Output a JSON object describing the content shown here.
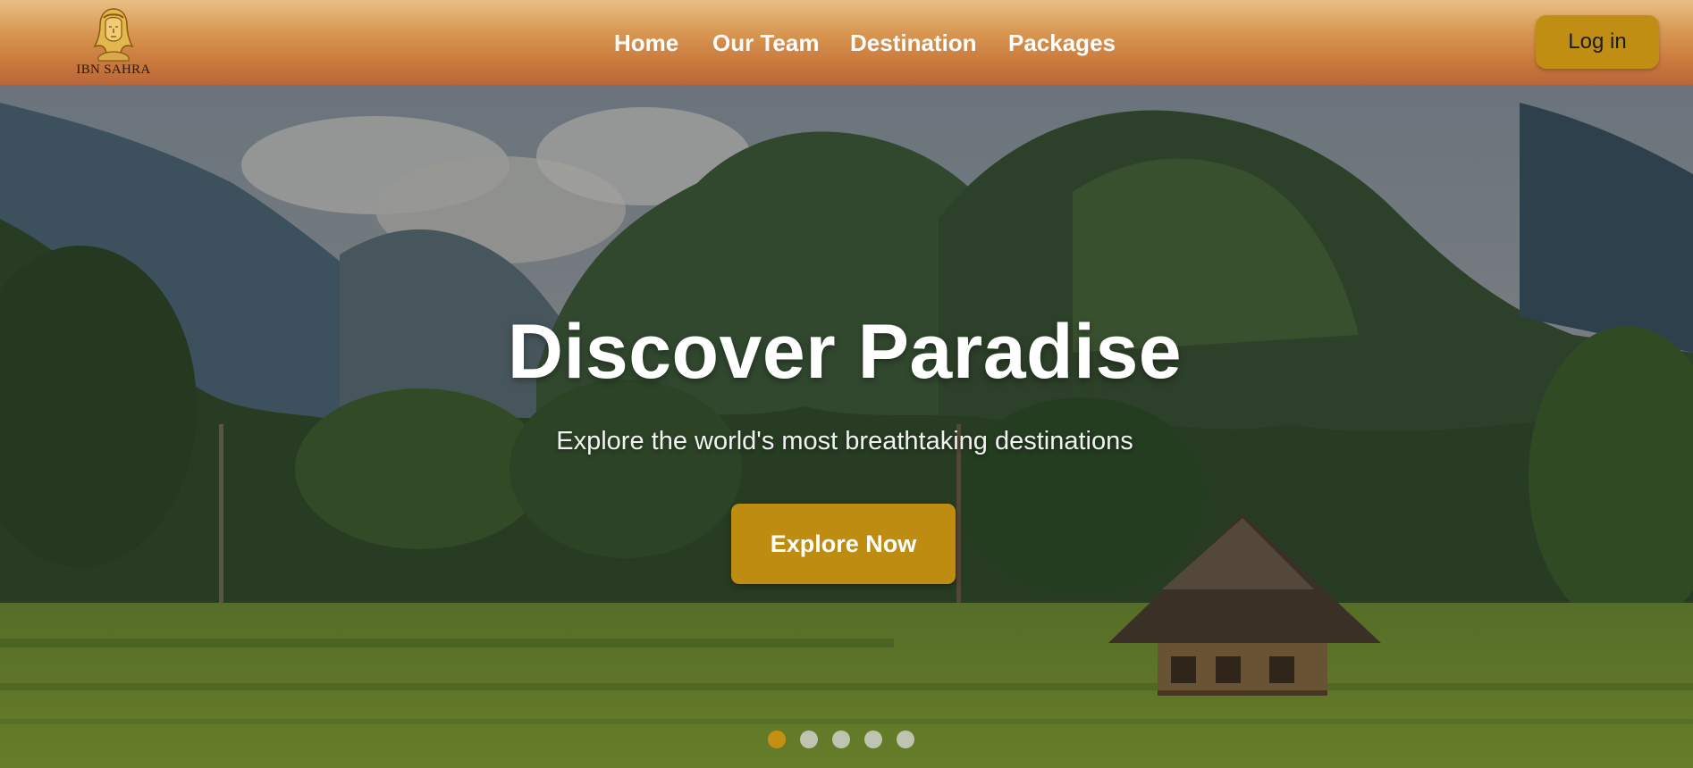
{
  "brand": {
    "name": "IBN SAHRA"
  },
  "nav": {
    "items": [
      {
        "label": "Home"
      },
      {
        "label": "Our Team"
      },
      {
        "label": "Destination"
      },
      {
        "label": "Packages"
      }
    ],
    "login_label": "Log in"
  },
  "hero": {
    "title": "Discover Paradise",
    "subtitle": "Explore the world's most breathtaking destinations",
    "cta_label": "Explore Now",
    "slides_total": 5,
    "active_slide": 1
  },
  "colors": {
    "accent": "#c08e12",
    "header_gradient_top": "#e9bf85",
    "header_gradient_bottom": "#b9663a"
  },
  "icons": {
    "logo": "bedouin-head-icon",
    "carousel": "carousel-dot-icon"
  }
}
